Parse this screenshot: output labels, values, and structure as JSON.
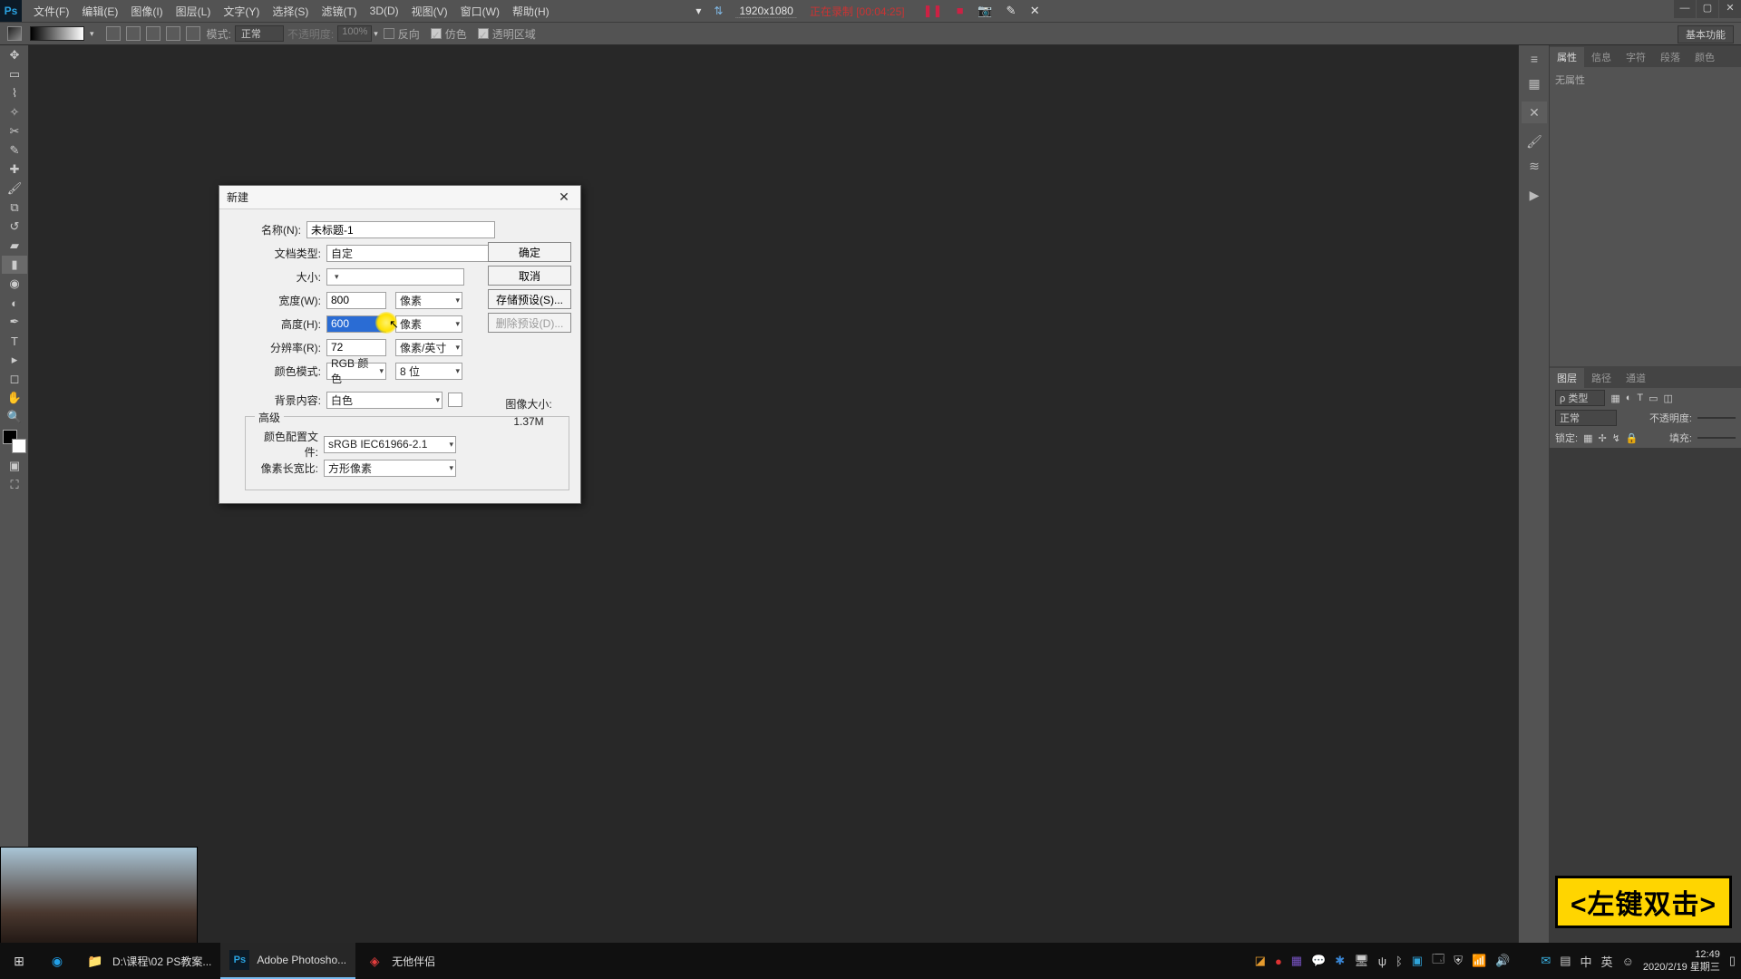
{
  "menubar": {
    "items": [
      "文件(F)",
      "编辑(E)",
      "图像(I)",
      "图层(L)",
      "文字(Y)",
      "选择(S)",
      "滤镜(T)",
      "3D(D)",
      "视图(V)",
      "窗口(W)",
      "帮助(H)"
    ]
  },
  "recorder": {
    "dims": "1920x1080",
    "state": "正在录制",
    "elapsed": "[00:04:25]"
  },
  "optbar": {
    "mode_label": "模式:",
    "mode_value": "正常",
    "opacity_label": "不透明度:",
    "opacity_value": "100%",
    "reverse": "反向",
    "dither": "仿色",
    "transparency": "透明区域",
    "right_button": "基本功能"
  },
  "panels": {
    "top_tabs": [
      "属性",
      "信息",
      "字符",
      "段落",
      "颜色"
    ],
    "top_active": 0,
    "prop_empty": "无属性",
    "bottom_tabs": [
      "图层",
      "路径",
      "通道"
    ],
    "bottom_active": 0,
    "layer_filter": "ρ 类型",
    "blend": "正常",
    "opacity_label": "不透明度:",
    "lock_label": "锁定:",
    "fill_label": "填充:"
  },
  "dialog": {
    "title": "新建",
    "labels": {
      "name": "名称(N):",
      "doc_type": "文档类型:",
      "size": "大小:",
      "width": "宽度(W):",
      "height": "高度(H):",
      "resolution": "分辨率(R):",
      "color_mode": "颜色模式:",
      "bg": "背景内容:",
      "advanced": "高级",
      "profile": "颜色配置文件:",
      "aspect": "像素长宽比:",
      "img_size": "图像大小:"
    },
    "values": {
      "name": "未标题-1",
      "doc_type": "自定",
      "size": "",
      "width": "800",
      "width_unit": "像素",
      "height": "600",
      "height_unit": "像素",
      "resolution": "72",
      "resolution_unit": "像素/英寸",
      "color_mode": "RGB 颜色",
      "color_depth": "8 位",
      "bg": "白色",
      "profile": "sRGB IEC61966-2.1",
      "aspect": "方形像素",
      "img_size": "1.37M"
    },
    "buttons": {
      "ok": "确定",
      "cancel": "取消",
      "save_preset": "存储预设(S)...",
      "del_preset": "删除预设(D)..."
    }
  },
  "sticker": "<左键双击>",
  "taskbar": {
    "items": [
      {
        "name": "start",
        "text": ""
      },
      {
        "name": "browser",
        "text": ""
      },
      {
        "name": "explorer",
        "text": "D:\\课程\\02 PS教案..."
      },
      {
        "name": "photoshop",
        "text": "Adobe Photosho..."
      },
      {
        "name": "companion",
        "text": "无他伴侣"
      }
    ],
    "active": "photoshop",
    "clock_time": "12:49",
    "clock_date": "2020/2/19 星期三",
    "ime_lang": "中",
    "ime_sub": "英"
  }
}
